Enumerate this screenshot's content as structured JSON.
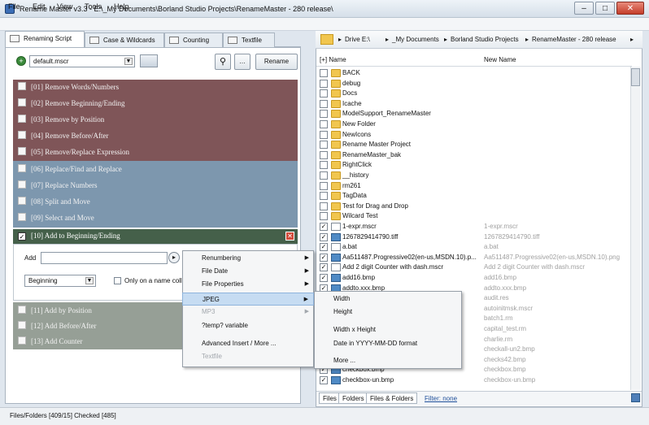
{
  "window": {
    "title": "Rename Master v3.3 - E:\\_My Documents\\Borland Studio Projects\\RenameMaster - 280 release\\"
  },
  "menubar": [
    "File",
    "Edit",
    "View",
    "Tools",
    "Help"
  ],
  "left_tabs": [
    "Renaming Script",
    "Case & Wildcards",
    "Counting",
    "Textfile"
  ],
  "script": {
    "file": "default.mscr",
    "rename_label": "Rename"
  },
  "methods": [
    {
      "label": "[01]  Remove Words/Numbers",
      "group": "red"
    },
    {
      "label": "[02]  Remove Beginning/Ending",
      "group": "red"
    },
    {
      "label": "[03]  Remove by Position",
      "group": "red"
    },
    {
      "label": "[04]  Remove Before/After",
      "group": "red"
    },
    {
      "label": "[05]  Remove/Replace Expression",
      "group": "red"
    },
    {
      "label": "[06]  Replace/Find and Replace",
      "group": "blue"
    },
    {
      "label": "[07]  Replace Numbers",
      "group": "blue"
    },
    {
      "label": "[08]  Split and Move",
      "group": "blue"
    },
    {
      "label": "[09]  Select and Move",
      "group": "blue"
    }
  ],
  "active_method": {
    "label": "[10]  Add to Beginning/Ending",
    "add_label": "Add",
    "position_value": "Beginning",
    "only_name_label": "Only on a name colli"
  },
  "methods_after": [
    "[11]  Add by Position",
    "[12]  Add Before/After",
    "[13]  Add Counter"
  ],
  "breadcrumb": [
    "Drive E:\\",
    "_My Documents",
    "Borland Studio Projects",
    "RenameMaster - 280 release"
  ],
  "columns": {
    "name": "[+] Name",
    "new_name": "New Name"
  },
  "files": [
    {
      "name": "BACK",
      "type": "folder",
      "checked": false,
      "new": ""
    },
    {
      "name": "debug",
      "type": "folder",
      "checked": false,
      "new": ""
    },
    {
      "name": "Docs",
      "type": "folder",
      "checked": false,
      "new": ""
    },
    {
      "name": "Icache",
      "type": "folder",
      "checked": false,
      "new": ""
    },
    {
      "name": "ModelSupport_RenameMaster",
      "type": "folder",
      "checked": false,
      "new": ""
    },
    {
      "name": "New Folder",
      "type": "folder",
      "checked": false,
      "new": ""
    },
    {
      "name": "NewIcons",
      "type": "folder",
      "checked": false,
      "new": ""
    },
    {
      "name": "Rename Master Project",
      "type": "folder",
      "checked": false,
      "new": ""
    },
    {
      "name": "RenameMaster_bak",
      "type": "folder",
      "checked": false,
      "new": ""
    },
    {
      "name": "RightClick",
      "type": "folder",
      "checked": false,
      "new": ""
    },
    {
      "name": "__history",
      "type": "folder",
      "checked": false,
      "new": ""
    },
    {
      "name": "rm261",
      "type": "folder",
      "checked": false,
      "new": ""
    },
    {
      "name": "TagData",
      "type": "folder",
      "checked": false,
      "new": ""
    },
    {
      "name": "Test for Drag and Drop",
      "type": "folder",
      "checked": false,
      "new": ""
    },
    {
      "name": "Wilcard Test",
      "type": "folder",
      "checked": false,
      "new": ""
    },
    {
      "name": "1-expr.mscr",
      "type": "file",
      "checked": true,
      "new": "1-expr.mscr"
    },
    {
      "name": "1267829414790.tiff",
      "type": "image",
      "checked": true,
      "new": "1267829414790.tiff"
    },
    {
      "name": "a.bat",
      "type": "file",
      "checked": true,
      "new": "a.bat"
    },
    {
      "name": "Aa511487.Progressive02(en-us,MSDN.10).p...",
      "type": "image",
      "checked": true,
      "new": "Aa511487.Progressive02(en-us,MSDN.10).png"
    },
    {
      "name": "Add 2 digit Counter with dash.mscr",
      "type": "file",
      "checked": true,
      "new": "Add 2 digit Counter with dash.mscr"
    },
    {
      "name": "add16.bmp",
      "type": "image",
      "checked": true,
      "new": "add16.bmp"
    },
    {
      "name": "addto.xxx.bmp",
      "type": "image",
      "checked": true,
      "new": "addto.xxx.bmp"
    },
    {
      "name": "",
      "type": "file",
      "checked": true,
      "new": "audit.res"
    },
    {
      "name": "",
      "type": "file",
      "checked": true,
      "new": "autoinitmsk.mscr"
    },
    {
      "name": "",
      "type": "file",
      "checked": true,
      "new": "batch1.rm"
    },
    {
      "name": "",
      "type": "file",
      "checked": true,
      "new": "capital_test.rm"
    },
    {
      "name": "",
      "type": "file",
      "checked": true,
      "new": "charlie.rm"
    },
    {
      "name": "",
      "type": "image",
      "checked": true,
      "new": "checkall-un2.bmp"
    },
    {
      "name": "",
      "type": "image",
      "checked": true,
      "new": "checks42.bmp"
    },
    {
      "name": "checkbox.bmp",
      "type": "image",
      "checked": true,
      "new": "checkbox.bmp"
    },
    {
      "name": "checkbox-un.bmp",
      "type": "image",
      "checked": true,
      "new": "checkbox-un.bmp"
    }
  ],
  "bottom_tabs": [
    "Files",
    "Folders",
    "Files & Folders"
  ],
  "filter_label": "Filter: none",
  "status": "Files/Folders [409/15] Checked [485]",
  "context_menu": [
    {
      "label": "Renumbering",
      "submenu": true,
      "disabled": false,
      "highlight": false
    },
    {
      "label": "File Date",
      "submenu": true,
      "disabled": false,
      "highlight": false
    },
    {
      "label": "File Properties",
      "submenu": true,
      "disabled": false,
      "highlight": false
    },
    {
      "label": "JPEG",
      "submenu": true,
      "disabled": false,
      "highlight": true
    },
    {
      "label": "MP3",
      "submenu": true,
      "disabled": true,
      "highlight": false
    },
    {
      "label": "?temp? variable",
      "submenu": false,
      "disabled": false,
      "highlight": false
    },
    {
      "label": "Advanced Insert / More ...",
      "submenu": false,
      "disabled": false,
      "highlight": false
    },
    {
      "label": "Textfile",
      "submenu": false,
      "disabled": true,
      "highlight": false
    }
  ],
  "jpeg_submenu": [
    "Width",
    "Height",
    "Width x Height",
    "Date in YYYY-MM-DD format",
    "More ..."
  ],
  "colors": {
    "red_group": "#7f5558",
    "blue_group": "#7d97ae",
    "active_group": "#45604a",
    "gray_group": "#969f96"
  }
}
